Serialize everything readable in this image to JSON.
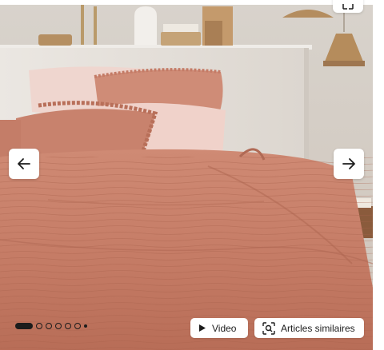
{
  "gallery": {
    "image_alt": "Bedroom with terracotta crinkled cotton duvet cover and ruffled pillows",
    "prev_icon": "arrow-left-icon",
    "next_icon": "arrow-right-icon",
    "corner_icon": "expand-icon",
    "dots": {
      "total": 8,
      "active_index": 0
    },
    "video_label": "Video",
    "video_icon": "play-icon",
    "similar_label": "Articles similaires",
    "similar_icon": "visual-search-icon",
    "colors": {
      "linen": "#c98470",
      "linen_shadow": "#a8604e",
      "wall": "#d9cfc6",
      "headboard": "#e8e3dd"
    }
  }
}
